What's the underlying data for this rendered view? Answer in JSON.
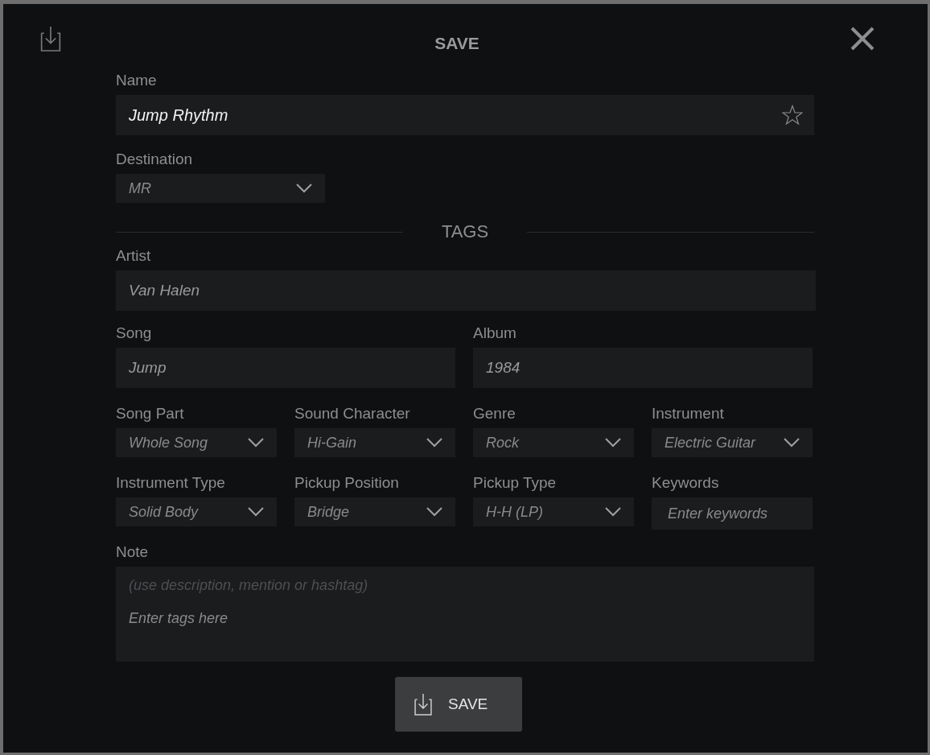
{
  "dialog": {
    "title": "SAVE"
  },
  "name": {
    "label": "Name",
    "value": "Jump Rhythm",
    "favorite": false
  },
  "destination": {
    "label": "Destination",
    "value": "MR"
  },
  "section_title": "TAGS",
  "rows": [
    [
      {
        "kind": "text",
        "label": "Artist",
        "value": "Van Halen"
      }
    ],
    [
      {
        "kind": "text",
        "label": "Song",
        "value": "Jump"
      },
      {
        "kind": "text",
        "label": "Album",
        "value": "1984"
      }
    ],
    [
      {
        "kind": "dropdown",
        "label": "Song Part",
        "value": "Whole Song"
      },
      {
        "kind": "dropdown",
        "label": "Sound Character",
        "value": "Hi-Gain"
      },
      {
        "kind": "dropdown",
        "label": "Genre",
        "value": "Rock"
      },
      {
        "kind": "dropdown",
        "label": "Instrument",
        "value": "Electric Guitar"
      }
    ],
    [
      {
        "kind": "dropdown",
        "label": "Instrument Type",
        "value": "Solid Body"
      },
      {
        "kind": "dropdown",
        "label": "Pickup Position",
        "value": "Bridge"
      },
      {
        "kind": "dropdown",
        "label": "Pickup Type",
        "value": "H-H (LP)"
      },
      {
        "kind": "text",
        "label": "Keywords",
        "placeholder": "Enter keywords"
      }
    ]
  ],
  "note": {
    "label": "Note",
    "hint": "(use description, mention or hashtag)",
    "placeholder": "Enter tags here"
  },
  "save_button": {
    "label": "SAVE"
  }
}
